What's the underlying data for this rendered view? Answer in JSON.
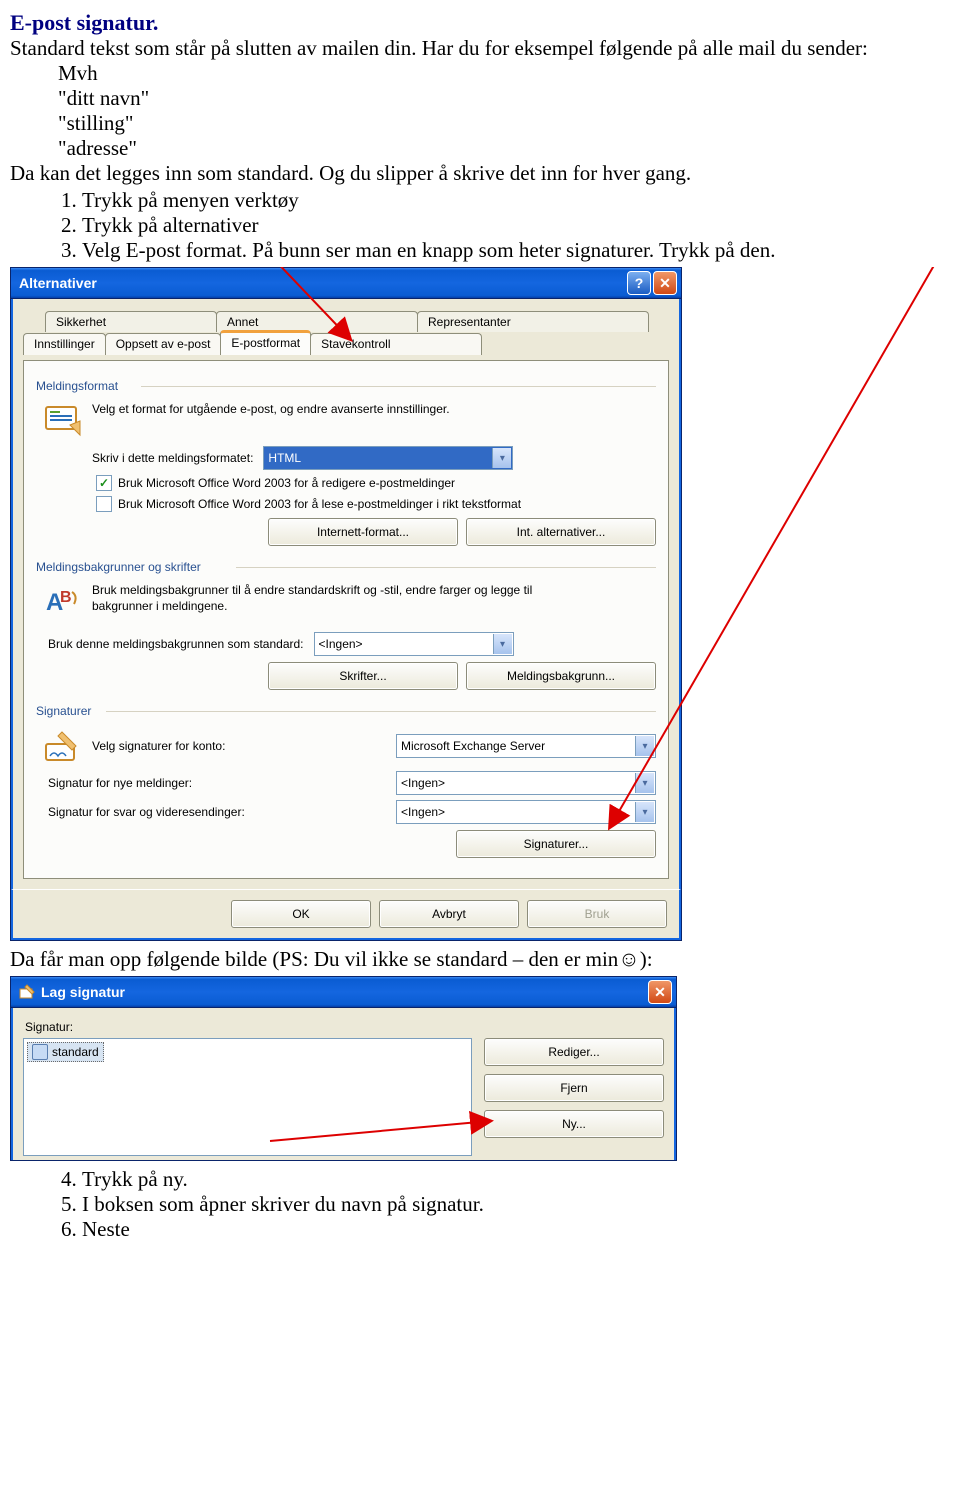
{
  "doc": {
    "heading": "E-post signatur.",
    "intro1": "Standard tekst som står på slutten av mailen din. Har du for eksempel følgende på alle mail du sender:",
    "sig_lines": [
      "Mvh",
      "\"ditt navn\"",
      "\"stilling\"",
      "\"adresse\""
    ],
    "intro2": "Da kan det legges inn som standard. Og du slipper å skrive det inn for hver gang.",
    "steps_a": [
      "Trykk på menyen verktøy",
      "Trykk på alternativer",
      "Velg E-post format. På bunn ser man en knapp som heter signaturer. Trykk på den."
    ],
    "between": "Da får man opp følgende bilde (PS: Du vil ikke se standard – den er min☺):",
    "steps_b": [
      "Trykk på ny.",
      "I boksen som åpner skriver du navn på signatur.",
      "Neste"
    ]
  },
  "dlg1": {
    "title": "Alternativer",
    "tabs_back": [
      "Sikkerhet",
      "Annet",
      "Representanter"
    ],
    "tabs_front": [
      "Innstillinger",
      "Oppsett av e-post",
      "E-postformat",
      "Stavekontroll"
    ],
    "g1": {
      "legend": "Meldingsformat",
      "desc": "Velg et format for utgående e-post, og endre avanserte innstillinger.",
      "fmt_label": "Skriv i dette meldingsformatet:",
      "fmt_value": "HTML",
      "chk1": "Bruk Microsoft Office Word 2003 for å redigere e-postmeldinger",
      "chk2": "Bruk Microsoft Office Word 2003 for å lese e-postmeldinger i rikt tekstformat",
      "btn1": "Internett-format...",
      "btn2": "Int. alternativer..."
    },
    "g2": {
      "legend": "Meldingsbakgrunner og skrifter",
      "desc": "Bruk meldingsbakgrunner til å endre standardskrift og -stil, endre farger og legge til bakgrunner i meldingene.",
      "bg_label": "Bruk denne meldingsbakgrunnen som standard:",
      "bg_value": "<Ingen>",
      "btn1": "Skrifter...",
      "btn2": "Meldingsbakgrunn..."
    },
    "g3": {
      "legend": "Signaturer",
      "desc": "Velg signaturer for konto:",
      "acct_value": "Microsoft Exchange Server",
      "new_label": "Signatur for nye meldinger:",
      "new_value": "<Ingen>",
      "fwd_label": "Signatur for svar og videresendinger:",
      "fwd_value": "<Ingen>",
      "btn": "Signaturer..."
    },
    "footer": {
      "ok": "OK",
      "cancel": "Avbryt",
      "apply": "Bruk"
    }
  },
  "dlg2": {
    "title": "Lag signatur",
    "label": "Signatur:",
    "item": "standard",
    "btn_edit": "Rediger...",
    "btn_del": "Fjern",
    "btn_new": "Ny..."
  }
}
